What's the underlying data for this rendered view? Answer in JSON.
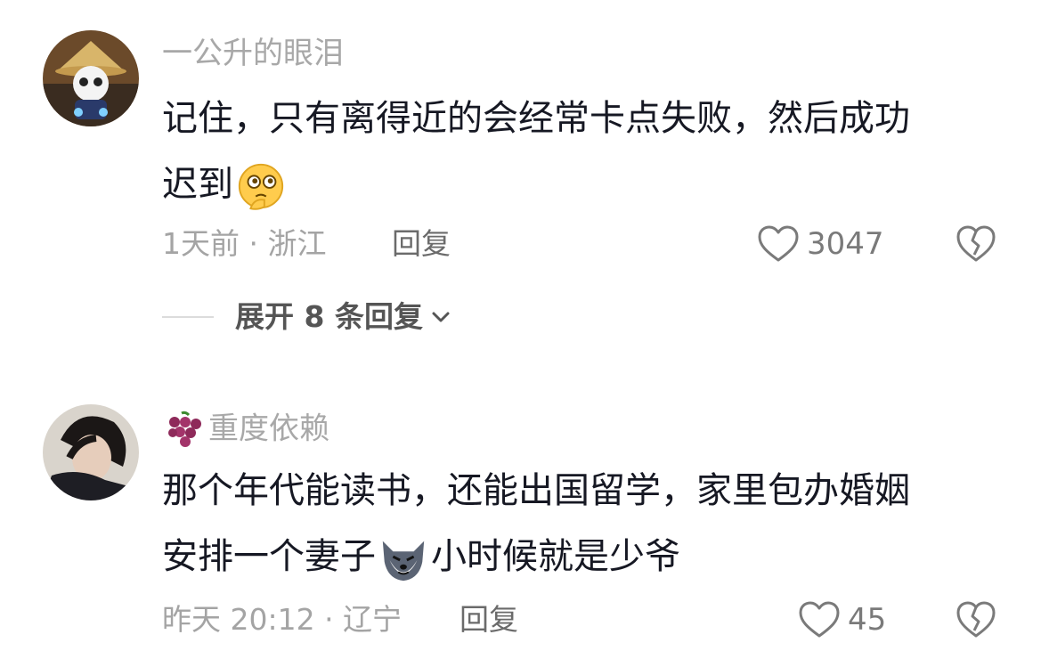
{
  "comments": [
    {
      "username": "一公升的眼泪",
      "text_line1": "记住，只有离得近的会经常卡点失败，然后成功",
      "text_line2": "迟到",
      "meta": "1天前 · 浙江",
      "reply_label": "回复",
      "likes": "3047",
      "expand_label": "展开 8 条回复"
    },
    {
      "username": "重度依赖",
      "text_line1": "那个年代能读书，还能出国留学，家里包办婚姻",
      "text_line2_a": "安排一个妻子",
      "text_line2_b": "小时候就是少爷",
      "meta": "昨天 20:12 · 辽宁",
      "reply_label": "回复",
      "likes": "45"
    }
  ]
}
